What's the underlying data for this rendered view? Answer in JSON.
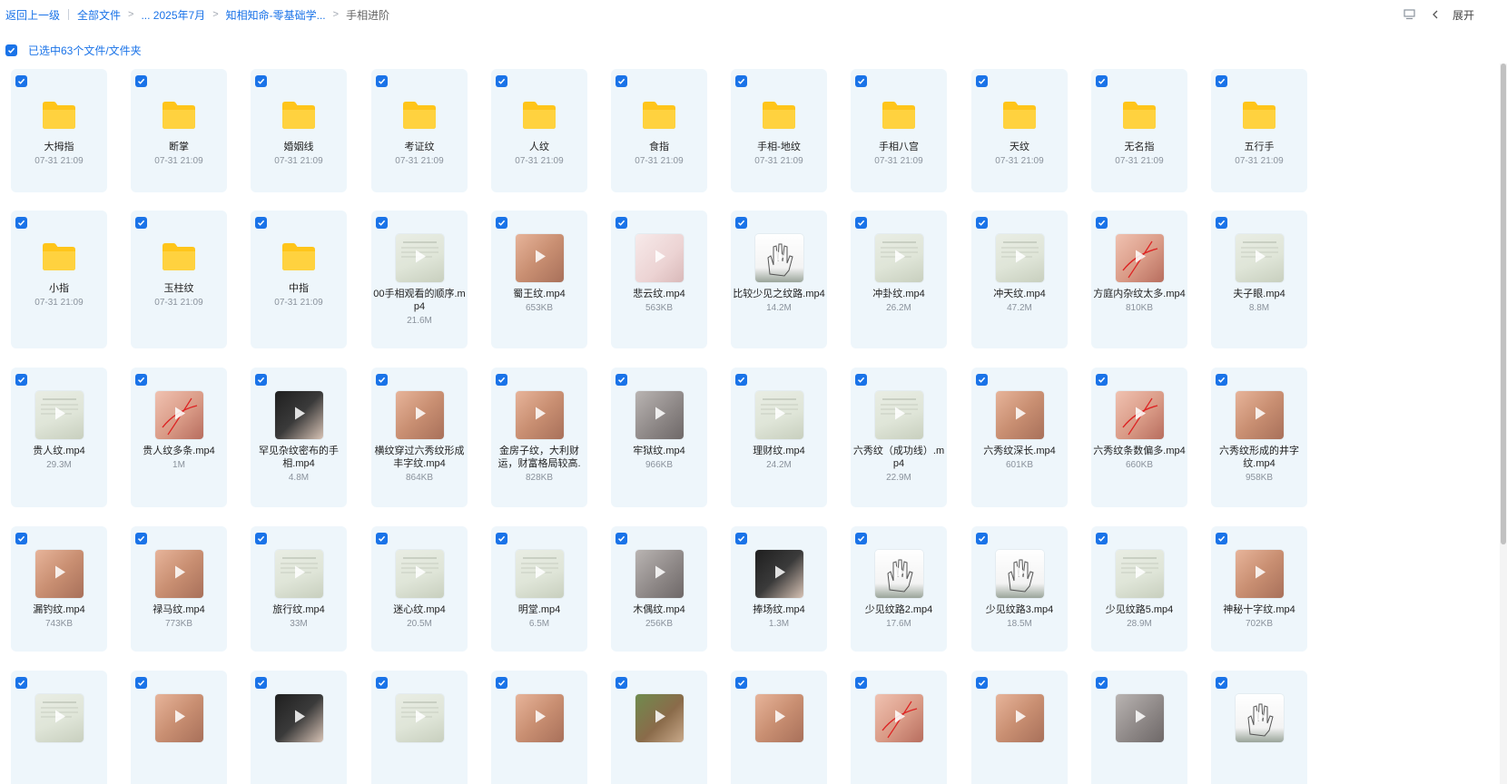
{
  "breadcrumb": {
    "back_label": "返回上一级",
    "items": [
      "全部文件",
      "... 2025年7月",
      "知相知命-零基础学...",
      "手相进阶"
    ]
  },
  "topbar": {
    "expand_label": "展开"
  },
  "selection": {
    "status": "已选中63个文件/文件夹"
  },
  "colors": {
    "accent": "#1a73e8",
    "card_bg": "#eef6fb",
    "folder": "#ffc51a"
  },
  "rows": [
    [
      {
        "name": "大拇指",
        "meta": "07-31 21:09",
        "type": "folder"
      },
      {
        "name": "断掌",
        "meta": "07-31 21:09",
        "type": "folder"
      },
      {
        "name": "婚姻线",
        "meta": "07-31 21:09",
        "type": "folder"
      },
      {
        "name": "考证纹",
        "meta": "07-31 21:09",
        "type": "folder"
      },
      {
        "name": "人纹",
        "meta": "07-31 21:09",
        "type": "folder"
      },
      {
        "name": "食指",
        "meta": "07-31 21:09",
        "type": "folder"
      },
      {
        "name": "手相-地纹",
        "meta": "07-31 21:09",
        "type": "folder"
      },
      {
        "name": "手相八宫",
        "meta": "07-31 21:09",
        "type": "folder"
      },
      {
        "name": "天纹",
        "meta": "07-31 21:09",
        "type": "folder"
      },
      {
        "name": "无名指",
        "meta": "07-31 21:09",
        "type": "folder"
      },
      {
        "name": "五行手",
        "meta": "07-31 21:09",
        "type": "folder"
      }
    ],
    [
      {
        "name": "小指",
        "meta": "07-31 21:09",
        "type": "folder"
      },
      {
        "name": "玉柱纹",
        "meta": "07-31 21:09",
        "type": "folder"
      },
      {
        "name": "中指",
        "meta": "07-31 21:09",
        "type": "folder"
      },
      {
        "name": "00手相观看的顺序.mp4",
        "meta": "21.6M",
        "type": "video",
        "thumb": "doc"
      },
      {
        "name": "蜀王纹.mp4",
        "meta": "653KB",
        "type": "video",
        "thumb": "skin"
      },
      {
        "name": "悲云纹.mp4",
        "meta": "563KB",
        "type": "video",
        "thumb": "pale"
      },
      {
        "name": "比较少见之纹路.mp4",
        "meta": "14.2M",
        "type": "video",
        "thumb": "hand"
      },
      {
        "name": "冲卦纹.mp4",
        "meta": "26.2M",
        "type": "video",
        "thumb": "doc"
      },
      {
        "name": "冲天纹.mp4",
        "meta": "47.2M",
        "type": "video",
        "thumb": "doc"
      },
      {
        "name": "方庭内杂纹太多.mp4",
        "meta": "810KB",
        "type": "video",
        "thumb": "redline"
      },
      {
        "name": "夫子眼.mp4",
        "meta": "8.8M",
        "type": "video",
        "thumb": "doc"
      }
    ],
    [
      {
        "name": "贵人纹.mp4",
        "meta": "29.3M",
        "type": "video",
        "thumb": "doc"
      },
      {
        "name": "贵人纹多条.mp4",
        "meta": "1M",
        "type": "video",
        "thumb": "redline"
      },
      {
        "name": "罕见杂纹密布的手相.mp4",
        "meta": "4.8M",
        "type": "video",
        "thumb": "dark"
      },
      {
        "name": "横纹穿过六秀纹形成丰字纹.mp4",
        "meta": "864KB",
        "type": "video",
        "thumb": "skin"
      },
      {
        "name": "金房子纹，大利财运，财富格局较高.",
        "meta": "828KB",
        "type": "video",
        "thumb": "skin"
      },
      {
        "name": "牢狱纹.mp4",
        "meta": "966KB",
        "type": "video",
        "thumb": "gray"
      },
      {
        "name": "理财纹.mp4",
        "meta": "24.2M",
        "type": "video",
        "thumb": "doc"
      },
      {
        "name": "六秀纹（成功线）.mp4",
        "meta": "22.9M",
        "type": "video",
        "thumb": "doc"
      },
      {
        "name": "六秀纹深长.mp4",
        "meta": "601KB",
        "type": "video",
        "thumb": "skin"
      },
      {
        "name": "六秀纹条数偏多.mp4",
        "meta": "660KB",
        "type": "video",
        "thumb": "redline"
      },
      {
        "name": "六秀纹形成的井字纹.mp4",
        "meta": "958KB",
        "type": "video",
        "thumb": "skin"
      }
    ],
    [
      {
        "name": "漏钓纹.mp4",
        "meta": "743KB",
        "type": "video",
        "thumb": "skin"
      },
      {
        "name": "禄马纹.mp4",
        "meta": "773KB",
        "type": "video",
        "thumb": "skin"
      },
      {
        "name": "旅行纹.mp4",
        "meta": "33M",
        "type": "video",
        "thumb": "doc"
      },
      {
        "name": "迷心纹.mp4",
        "meta": "20.5M",
        "type": "video",
        "thumb": "doc"
      },
      {
        "name": "明堂.mp4",
        "meta": "6.5M",
        "type": "video",
        "thumb": "doc"
      },
      {
        "name": "木偶纹.mp4",
        "meta": "256KB",
        "type": "video",
        "thumb": "gray"
      },
      {
        "name": "捧场纹.mp4",
        "meta": "1.3M",
        "type": "video",
        "thumb": "dark"
      },
      {
        "name": "少见纹路2.mp4",
        "meta": "17.6M",
        "type": "video",
        "thumb": "hand"
      },
      {
        "name": "少见纹路3.mp4",
        "meta": "18.5M",
        "type": "video",
        "thumb": "hand"
      },
      {
        "name": "少见纹路5.mp4",
        "meta": "28.9M",
        "type": "video",
        "thumb": "doc"
      },
      {
        "name": "神秘十字纹.mp4",
        "meta": "702KB",
        "type": "video",
        "thumb": "skin"
      }
    ],
    [
      {
        "name": "",
        "meta": "",
        "type": "video",
        "thumb": "doc"
      },
      {
        "name": "",
        "meta": "",
        "type": "video",
        "thumb": "skin"
      },
      {
        "name": "",
        "meta": "",
        "type": "video",
        "thumb": "dark"
      },
      {
        "name": "",
        "meta": "",
        "type": "video",
        "thumb": "doc"
      },
      {
        "name": "",
        "meta": "",
        "type": "video",
        "thumb": "skin"
      },
      {
        "name": "",
        "meta": "",
        "type": "video",
        "thumb": "green"
      },
      {
        "name": "",
        "meta": "",
        "type": "video",
        "thumb": "skin"
      },
      {
        "name": "",
        "meta": "",
        "type": "video",
        "thumb": "redline"
      },
      {
        "name": "",
        "meta": "",
        "type": "video",
        "thumb": "skin"
      },
      {
        "name": "",
        "meta": "",
        "type": "video",
        "thumb": "gray"
      },
      {
        "name": "",
        "meta": "",
        "type": "video",
        "thumb": "hand"
      }
    ]
  ]
}
